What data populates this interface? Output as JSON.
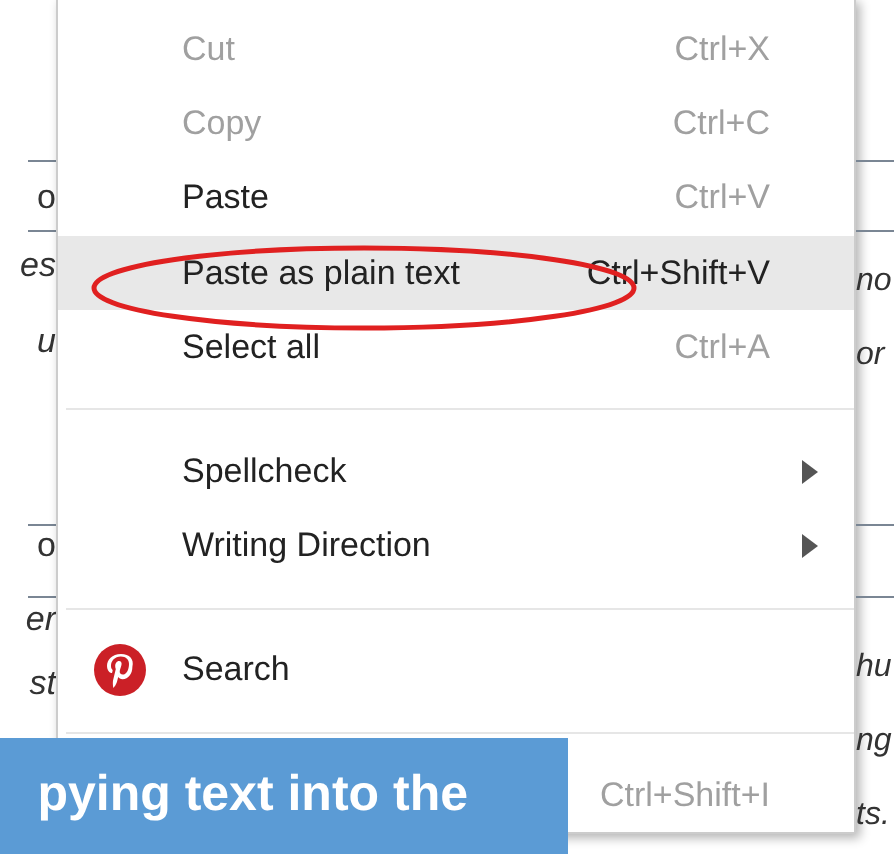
{
  "background": {
    "left_fragments": [
      {
        "text": "o",
        "italic": false
      },
      {
        "text": "es",
        "italic": true
      },
      {
        "text": "u",
        "italic": true
      },
      {
        "text": "o",
        "italic": false
      },
      {
        "text": "er",
        "italic": true
      },
      {
        "text": "st",
        "italic": true
      }
    ],
    "right_fragments": [
      {
        "text": "no",
        "italic": true
      },
      {
        "text": "or",
        "italic": true
      },
      {
        "text": "hu",
        "italic": true
      },
      {
        "text": "ng",
        "italic": true
      },
      {
        "text": "ts.",
        "italic": true
      }
    ]
  },
  "context_menu": {
    "items": [
      {
        "kind": "item",
        "label": "Cut",
        "shortcut": "Ctrl+X",
        "disabled": true,
        "selected": false
      },
      {
        "kind": "item",
        "label": "Copy",
        "shortcut": "Ctrl+C",
        "disabled": true,
        "selected": false
      },
      {
        "kind": "item",
        "label": "Paste",
        "shortcut": "Ctrl+V",
        "disabled": false,
        "selected": false
      },
      {
        "kind": "item",
        "label": "Paste as plain text",
        "shortcut": "Ctrl+Shift+V",
        "disabled": false,
        "selected": true
      },
      {
        "kind": "item",
        "label": "Select all",
        "shortcut": "Ctrl+A",
        "disabled": false,
        "selected": false
      },
      {
        "kind": "separator"
      },
      {
        "kind": "submenu",
        "label": "Spellcheck"
      },
      {
        "kind": "submenu",
        "label": "Writing Direction"
      },
      {
        "kind": "separator"
      },
      {
        "kind": "pin-item",
        "label": "Search"
      },
      {
        "kind": "separator"
      },
      {
        "kind": "item",
        "shortcut": "Ctrl+Shift+I",
        "disabled": true,
        "selected": false
      }
    ]
  },
  "caption": {
    "text": "pying text into the"
  }
}
